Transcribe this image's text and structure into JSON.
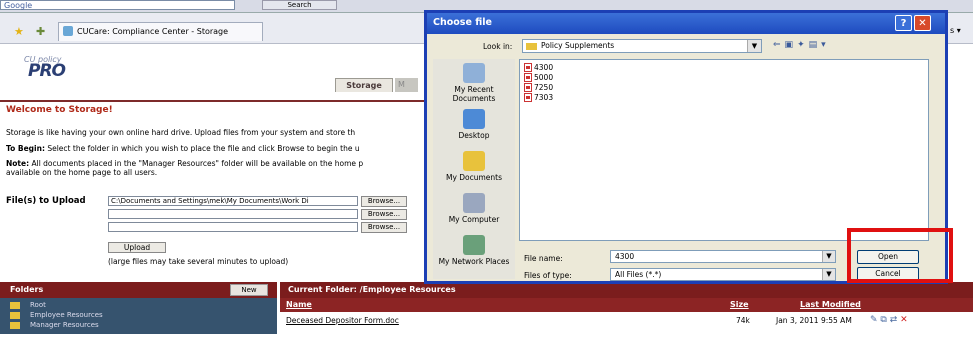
{
  "browser": {
    "search_text": "Google",
    "search_button": "Search",
    "tab_title": "CUCare: Compliance Center - Storage",
    "tab_right": "s"
  },
  "logo": {
    "small": "CU policy",
    "big": "PRO"
  },
  "page": {
    "tab_storage": "Storage",
    "tab_next": "M",
    "welcome": "Welcome to Storage!",
    "intro": "Storage is like having your own online hard drive. Upload files from your system and store th",
    "to_begin_label": "To Begin:",
    "to_begin": " Select the folder in which you wish to place the file and click Browse to begin the u",
    "note_label": "Note:",
    "note": " All documents placed in the \"Manager Resources\" folder will be available on the home p",
    "note_line2": "available on the home page to all users.",
    "files_label": "File(s) to Upload",
    "file_inputs": [
      "C:\\Documents and Settings\\mek\\My Documents\\Work Di",
      "",
      ""
    ],
    "browse_label": "Browse...",
    "upload_label": "Upload",
    "upload_note": "(large files may take several minutes to upload)"
  },
  "folders": {
    "header": "Folders",
    "new_label": "New",
    "items": [
      "Root",
      "Employee Resources",
      "Manager Resources"
    ]
  },
  "current": {
    "header": "Current Folder: /Employee Resources",
    "col_name": "Name",
    "col_size": "Size",
    "col_modified": "Last Modified",
    "row": {
      "name": "Deceased Depositor Form.doc",
      "size": "74k",
      "modified": "Jan 3, 2011 9:55 AM"
    }
  },
  "dialog": {
    "title": "Choose file",
    "look_in_label": "Look in:",
    "look_in_value": "Policy Supplements",
    "places": [
      "My Recent Documents",
      "Desktop",
      "My Documents",
      "My Computer",
      "My Network Places"
    ],
    "files": [
      "4300",
      "5000",
      "7250",
      "7303"
    ],
    "file_name_label": "File name:",
    "file_name_value": "4300",
    "file_type_label": "Files of type:",
    "file_type_value": "All Files (*.*)",
    "open_label": "Open",
    "cancel_label": "Cancel"
  },
  "colors": {
    "accent_dark_red": "#7b1d1d",
    "dialog_blue": "#1c3fb4",
    "highlight_red": "#e01010"
  }
}
